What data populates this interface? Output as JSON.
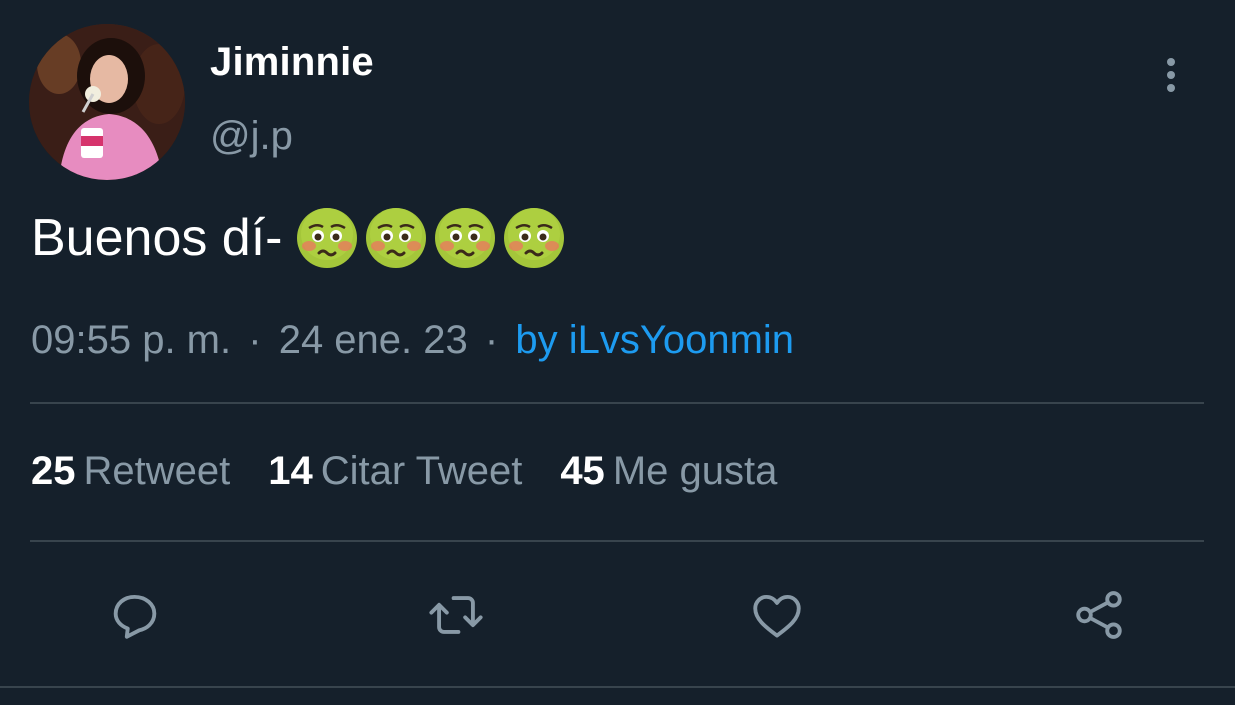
{
  "author": {
    "display_name": "Jiminnie",
    "handle": "@j.p",
    "avatar": "profile-photo"
  },
  "more_icon": "more-vertical-icon",
  "tweet": {
    "text": "Buenos dí-",
    "emojis": [
      "nauseated-face-emoji",
      "nauseated-face-emoji",
      "nauseated-face-emoji",
      "nauseated-face-emoji"
    ]
  },
  "meta": {
    "time": "09:55 p. m.",
    "separator": "·",
    "date": "24 ene. 23",
    "source": "by iLvsYoonmin"
  },
  "stats": {
    "retweets": {
      "count": "25",
      "label": "Retweet"
    },
    "quotes": {
      "count": "14",
      "label": "Citar Tweet"
    },
    "likes": {
      "count": "45",
      "label": "Me gusta"
    }
  },
  "actions": [
    "reply-icon",
    "retweet-icon",
    "like-icon",
    "share-icon"
  ],
  "colors": {
    "background": "#15202b",
    "primary_text": "#ffffff",
    "secondary_text": "#8899a6",
    "link": "#1d9bf0",
    "divider": "#38444d"
  }
}
